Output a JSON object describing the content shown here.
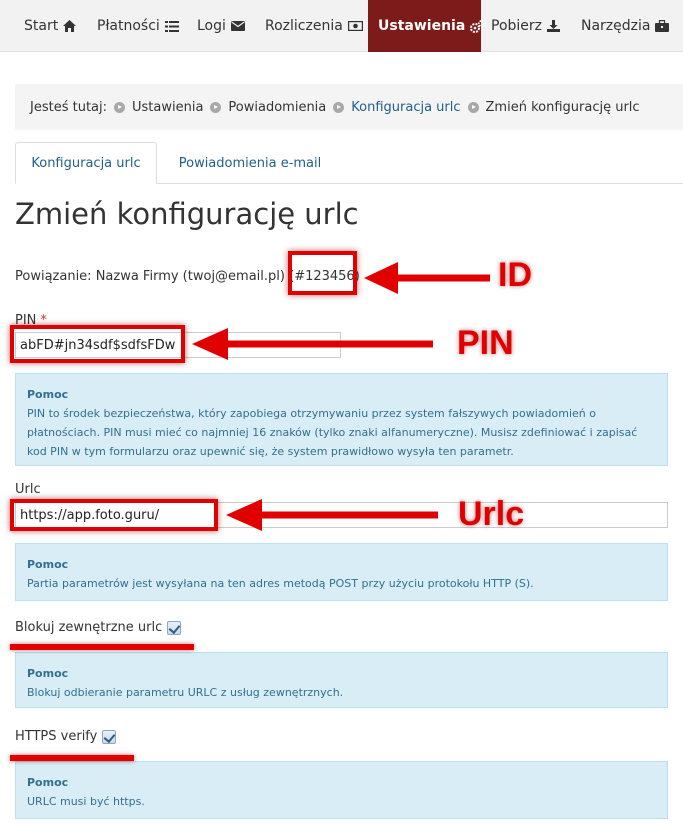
{
  "nav": {
    "items": [
      {
        "label": "Start",
        "icon": "home-icon"
      },
      {
        "label": "Płatności",
        "icon": "list-icon"
      },
      {
        "label": "Logi",
        "icon": "envelope-icon"
      },
      {
        "label": "Rozliczenia",
        "icon": "money-icon"
      },
      {
        "label": "Ustawienia",
        "icon": "cogs-icon",
        "active": true
      },
      {
        "label": "Pobierz",
        "icon": "download-icon"
      },
      {
        "label": "Narzędzia",
        "icon": "briefcase-icon"
      }
    ],
    "active_color": "#7d1b1b"
  },
  "breadcrumb": {
    "prefix": "Jesteś tutaj:",
    "items": [
      "Ustawienia",
      "Powiadomienia",
      "Konfiguracja urlc",
      "Zmień konfigurację urlc"
    ]
  },
  "tabs": [
    "Konfiguracja urlc",
    "Powiadomienia e-mail"
  ],
  "page_title": "Zmień konfigurację urlc",
  "association": {
    "text_before": "Powiązanie: Nazwa Firmy (twoj@email.pl) (",
    "id": "#123456",
    "text_after": ")"
  },
  "pin": {
    "label": "PIN",
    "required_mark": "*",
    "value": "abFD#jn34sdf$sdfsFDw",
    "help_title": "Pomoc",
    "help_text": "PIN to środek bezpieczeństwa, który zapobiega otrzymywaniu przez system fałszywych powiadomień o płatnościach. PIN musi mieć co najmniej 16 znaków (tylko znaki alfanumeryczne). Musisz zdefiniować i zapisać kod PIN w tym formularzu oraz upewnić się, że system prawidłowo wysyła ten parametr."
  },
  "urlc": {
    "label": "Urlc",
    "value": "https://app.foto.guru/",
    "help_title": "Pomoc",
    "help_text": "Partia parametrów jest wysyłana na ten adres metodą POST przy użyciu protokołu HTTP (S)."
  },
  "block_external": {
    "label": "Blokuj zewnętrzne urlc",
    "checked": true,
    "help_title": "Pomoc",
    "help_text": "Blokuj odbieranie parametru URLC z usług zewnętrznych."
  },
  "https_verify": {
    "label": "HTTPS verify",
    "checked": true,
    "help_title": "Pomoc",
    "help_text": "URLC musi być https."
  },
  "annotations": {
    "id_label": "ID",
    "pin_label": "PIN",
    "urlc_label": "Urlc",
    "color": "#e00000"
  }
}
